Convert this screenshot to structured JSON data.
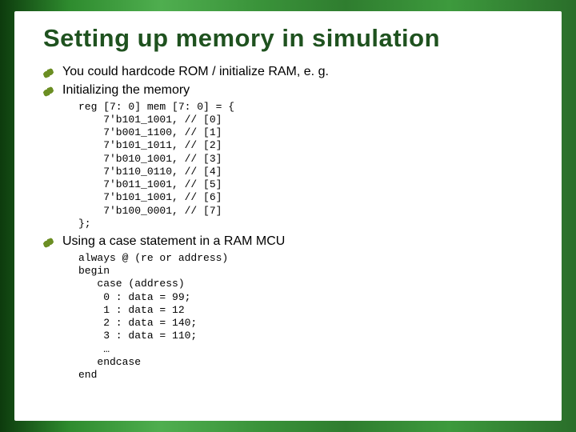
{
  "title": "Setting up memory in simulation",
  "bullets": {
    "b0": "You could hardcode ROM / initialize RAM, e. g.",
    "b1": "Initializing the memory",
    "b2": "Using a case statement in a RAM MCU"
  },
  "code": {
    "mem_init": "reg [7: 0] mem [7: 0] = {\n    7'b101_1001, // [0]\n    7'b001_1100, // [1]\n    7'b101_1011, // [2]\n    7'b010_1001, // [3]\n    7'b110_0110, // [4]\n    7'b011_1001, // [5]\n    7'b101_1001, // [6]\n    7'b100_0001, // [7]\n};",
    "case_stmt": "always @ (re or address)\nbegin\n   case (address)\n    0 : data = 99;\n    1 : data = 12\n    2 : data = 140;\n    3 : data = 110;\n    …\n   endcase\nend"
  }
}
